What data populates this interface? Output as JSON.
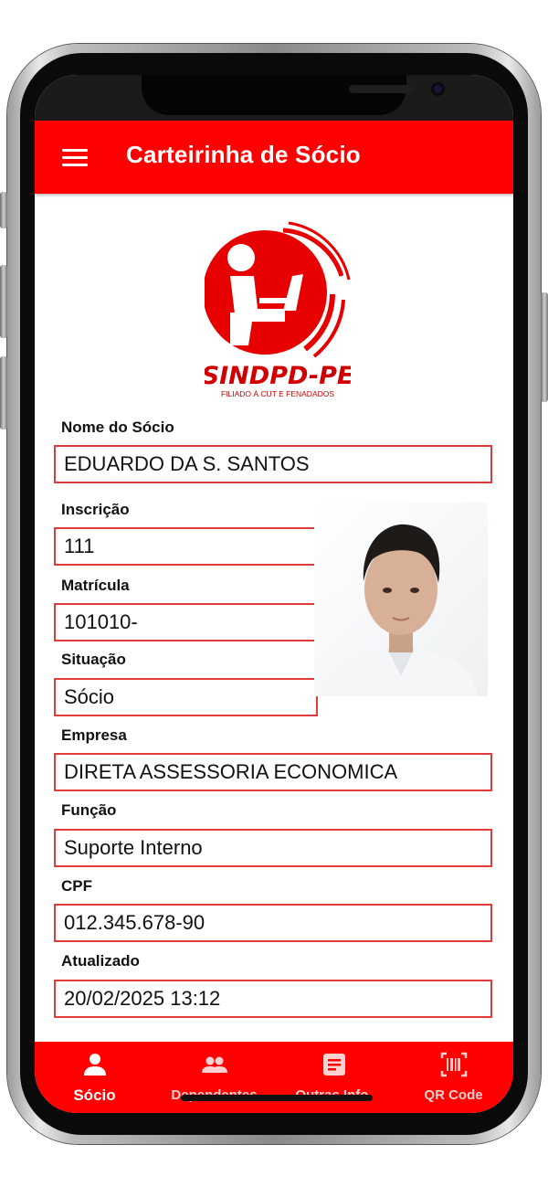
{
  "app_bar": {
    "title": "Carteirinha de Sócio",
    "menu_icon": "hamburger-menu-icon"
  },
  "logo": {
    "name": "SINDPD-PE",
    "tagline": "FILIADO À CUT E FENADADOS"
  },
  "fields": {
    "nome": {
      "label": "Nome do Sócio",
      "value": "EDUARDO DA S. SANTOS"
    },
    "inscricao": {
      "label": "Inscrição",
      "value": "111"
    },
    "matricula": {
      "label": "Matrícula",
      "value": "101010-"
    },
    "situacao": {
      "label": "Situação",
      "value": "Sócio"
    },
    "empresa": {
      "label": "Empresa",
      "value": "DIRETA ASSESSORIA ECONOMICA"
    },
    "funcao": {
      "label": "Função",
      "value": "Suporte Interno"
    },
    "cpf": {
      "label": "CPF",
      "value": "012.345.678-90"
    },
    "atualizado": {
      "label": "Atualizado",
      "value": "20/02/2025 13:12"
    }
  },
  "bottom_nav": [
    {
      "label": "Sócio",
      "icon": "person-icon",
      "active": true
    },
    {
      "label": "Dependentes",
      "icon": "group-icon",
      "active": false
    },
    {
      "label": "Outras Info.",
      "icon": "document-icon",
      "active": false
    },
    {
      "label": "QR Code",
      "icon": "barcode-scan-icon",
      "active": false
    }
  ],
  "colors": {
    "primary": "#ff0000",
    "field_border": "#e23a3a"
  }
}
